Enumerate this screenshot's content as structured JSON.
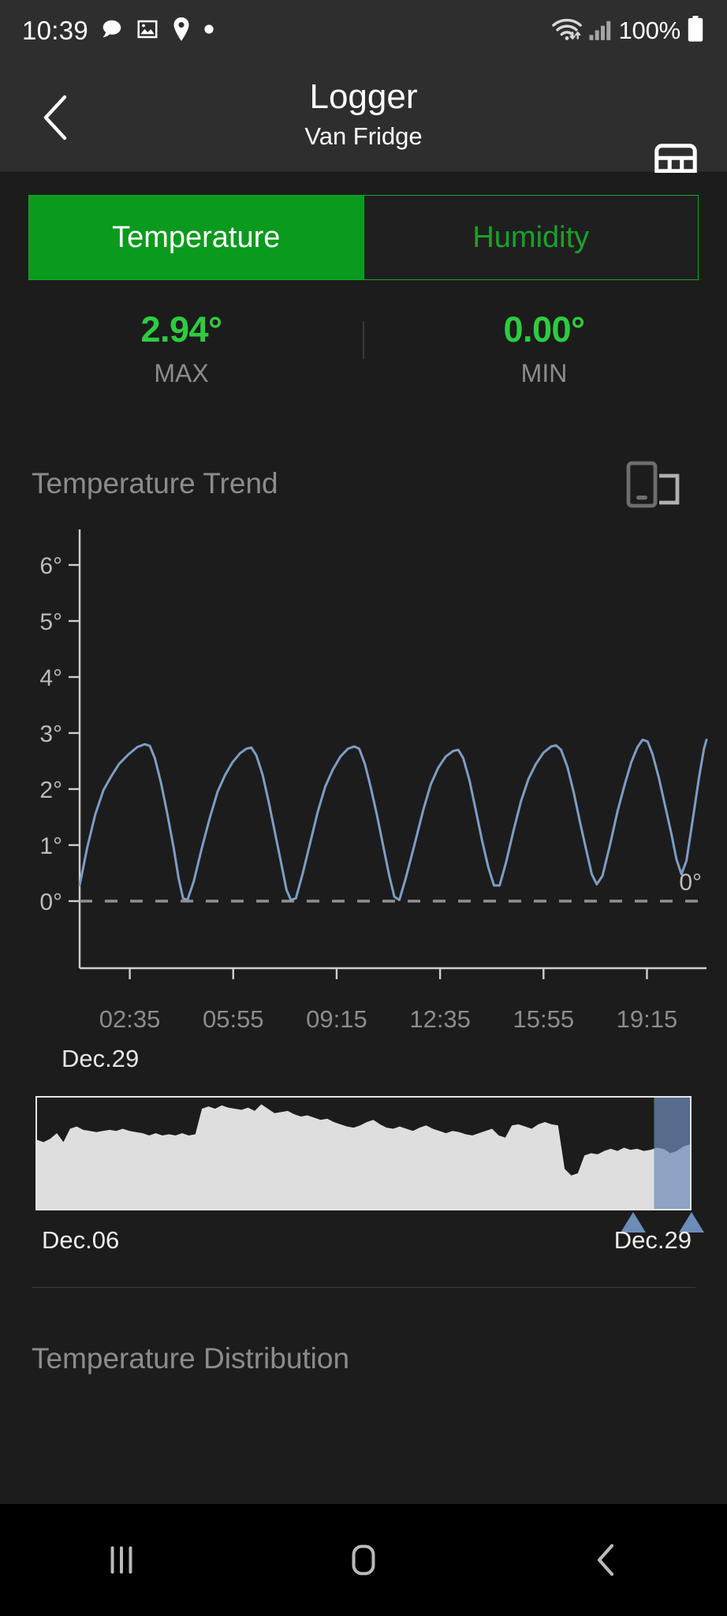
{
  "statusbar": {
    "clock": "10:39",
    "icons": [
      "chat-bubble-icon",
      "image-icon",
      "location-pin-icon",
      "dot-icon"
    ],
    "wifi": "wifi-icon",
    "signal": "cellular-signal-icon",
    "battery_text": "100%",
    "battery": "battery-full-icon"
  },
  "appbar": {
    "back": "back-chevron-icon",
    "title": "Logger",
    "subtitle": "Van Fridge",
    "table_action": "table-grid-icon"
  },
  "tabs": {
    "temperature": "Temperature",
    "humidity": "Humidity",
    "active": "Temperature"
  },
  "stats": {
    "max_value": "2.94°",
    "max_label": "MAX",
    "min_value": "0.00°",
    "min_label": "MIN"
  },
  "trend": {
    "title": "Temperature Trend",
    "rotate_icon": "rotate-screen-icon",
    "zero_line_label": "0°",
    "date_label": "Dec.29"
  },
  "range": {
    "start_label": "Dec.06",
    "end_label": "Dec.29"
  },
  "distribution": {
    "title": "Temperature Distribution"
  },
  "navbar": {
    "recents": "recents-icon",
    "home": "home-icon",
    "back": "back-icon"
  },
  "colors": {
    "accent_green": "#0a9a1d",
    "accent_green_text": "#17a32a",
    "stat_green": "#2ecc40",
    "line_blue": "#7d9dc4",
    "range_fill": "#dedede",
    "handle_blue": "#6d8cb8",
    "background": "#1c1c1c",
    "bar_background": "#2e2e2e"
  },
  "chart_data": {
    "type": "line",
    "title": "Temperature Trend",
    "xlabel": "",
    "ylabel": "",
    "ylim": [
      0,
      6.5
    ],
    "yticks": [
      "0°",
      "1°",
      "2°",
      "3°",
      "4°",
      "5°",
      "6°"
    ],
    "ytick_values": [
      0,
      1,
      2,
      3,
      4,
      5,
      6
    ],
    "xticks": [
      "02:35",
      "05:55",
      "09:15",
      "12:35",
      "15:55",
      "19:15"
    ],
    "xtick_positions": [
      0.08,
      0.245,
      0.41,
      0.575,
      0.74,
      0.905
    ],
    "grid": false,
    "legend": null,
    "reference_line": {
      "value": 0,
      "label": "0°",
      "style": "dashed"
    },
    "series": [
      {
        "name": "Temperature",
        "color": "#7d9dc4",
        "points": [
          [
            0.0,
            0.28
          ],
          [
            0.012,
            0.95
          ],
          [
            0.025,
            1.55
          ],
          [
            0.038,
            1.98
          ],
          [
            0.05,
            2.22
          ],
          [
            0.063,
            2.45
          ],
          [
            0.078,
            2.62
          ],
          [
            0.092,
            2.75
          ],
          [
            0.104,
            2.8
          ],
          [
            0.112,
            2.77
          ],
          [
            0.12,
            2.55
          ],
          [
            0.13,
            2.1
          ],
          [
            0.14,
            1.55
          ],
          [
            0.15,
            0.95
          ],
          [
            0.158,
            0.4
          ],
          [
            0.165,
            0.05
          ],
          [
            0.172,
            0.02
          ],
          [
            0.182,
            0.35
          ],
          [
            0.195,
            0.95
          ],
          [
            0.208,
            1.5
          ],
          [
            0.22,
            1.95
          ],
          [
            0.232,
            2.25
          ],
          [
            0.244,
            2.48
          ],
          [
            0.256,
            2.64
          ],
          [
            0.266,
            2.72
          ],
          [
            0.274,
            2.74
          ],
          [
            0.282,
            2.6
          ],
          [
            0.292,
            2.25
          ],
          [
            0.302,
            1.75
          ],
          [
            0.312,
            1.2
          ],
          [
            0.322,
            0.65
          ],
          [
            0.33,
            0.2
          ],
          [
            0.337,
            0.02
          ],
          [
            0.345,
            0.05
          ],
          [
            0.356,
            0.5
          ],
          [
            0.368,
            1.05
          ],
          [
            0.38,
            1.6
          ],
          [
            0.392,
            2.05
          ],
          [
            0.404,
            2.35
          ],
          [
            0.416,
            2.58
          ],
          [
            0.428,
            2.72
          ],
          [
            0.438,
            2.76
          ],
          [
            0.446,
            2.72
          ],
          [
            0.455,
            2.45
          ],
          [
            0.464,
            2.05
          ],
          [
            0.474,
            1.55
          ],
          [
            0.484,
            1.0
          ],
          [
            0.494,
            0.45
          ],
          [
            0.502,
            0.08
          ],
          [
            0.51,
            0.02
          ],
          [
            0.52,
            0.4
          ],
          [
            0.534,
            1.0
          ],
          [
            0.548,
            1.62
          ],
          [
            0.56,
            2.08
          ],
          [
            0.572,
            2.38
          ],
          [
            0.584,
            2.58
          ],
          [
            0.596,
            2.68
          ],
          [
            0.604,
            2.7
          ],
          [
            0.612,
            2.55
          ],
          [
            0.622,
            2.15
          ],
          [
            0.632,
            1.62
          ],
          [
            0.642,
            1.08
          ],
          [
            0.652,
            0.6
          ],
          [
            0.661,
            0.28
          ],
          [
            0.67,
            0.28
          ],
          [
            0.68,
            0.68
          ],
          [
            0.692,
            1.25
          ],
          [
            0.704,
            1.78
          ],
          [
            0.716,
            2.18
          ],
          [
            0.728,
            2.45
          ],
          [
            0.74,
            2.65
          ],
          [
            0.752,
            2.76
          ],
          [
            0.76,
            2.78
          ],
          [
            0.768,
            2.7
          ],
          [
            0.778,
            2.4
          ],
          [
            0.788,
            1.95
          ],
          [
            0.798,
            1.42
          ],
          [
            0.808,
            0.92
          ],
          [
            0.817,
            0.48
          ],
          [
            0.825,
            0.3
          ],
          [
            0.834,
            0.45
          ],
          [
            0.846,
            1.0
          ],
          [
            0.858,
            1.6
          ],
          [
            0.87,
            2.1
          ],
          [
            0.88,
            2.48
          ],
          [
            0.89,
            2.75
          ],
          [
            0.898,
            2.88
          ],
          [
            0.906,
            2.85
          ],
          [
            0.914,
            2.62
          ],
          [
            0.924,
            2.2
          ],
          [
            0.934,
            1.7
          ],
          [
            0.944,
            1.2
          ],
          [
            0.952,
            0.75
          ],
          [
            0.96,
            0.48
          ],
          [
            0.968,
            0.72
          ],
          [
            0.978,
            1.45
          ],
          [
            0.988,
            2.2
          ],
          [
            0.996,
            2.72
          ],
          [
            1.0,
            2.88
          ]
        ]
      }
    ]
  },
  "range_chart_data": {
    "type": "area",
    "color": "#dedede",
    "x_start": "Dec.06",
    "x_end": "Dec.29",
    "selection": [
      0.945,
      1.0
    ],
    "values": [
      0.62,
      0.6,
      0.63,
      0.68,
      0.6,
      0.72,
      0.74,
      0.71,
      0.7,
      0.69,
      0.7,
      0.71,
      0.7,
      0.72,
      0.7,
      0.69,
      0.68,
      0.66,
      0.68,
      0.66,
      0.67,
      0.66,
      0.68,
      0.66,
      0.67,
      0.9,
      0.92,
      0.9,
      0.93,
      0.91,
      0.9,
      0.89,
      0.91,
      0.88,
      0.94,
      0.9,
      0.86,
      0.87,
      0.88,
      0.85,
      0.83,
      0.84,
      0.82,
      0.8,
      0.81,
      0.78,
      0.76,
      0.74,
      0.73,
      0.75,
      0.78,
      0.8,
      0.76,
      0.73,
      0.72,
      0.74,
      0.72,
      0.7,
      0.73,
      0.75,
      0.72,
      0.7,
      0.68,
      0.7,
      0.69,
      0.67,
      0.66,
      0.68,
      0.7,
      0.72,
      0.66,
      0.64,
      0.75,
      0.76,
      0.74,
      0.72,
      0.76,
      0.78,
      0.76,
      0.75,
      0.36,
      0.3,
      0.32,
      0.48,
      0.5,
      0.49,
      0.52,
      0.54,
      0.52,
      0.55,
      0.53,
      0.54,
      0.52,
      0.53,
      0.55,
      0.54,
      0.5,
      0.52,
      0.56,
      0.58
    ]
  }
}
